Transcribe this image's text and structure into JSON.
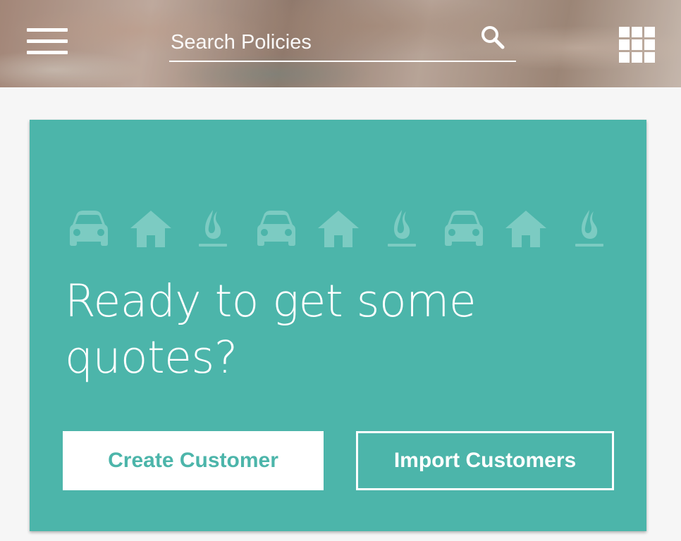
{
  "header": {
    "menu_icon": "hamburger-menu-icon",
    "search": {
      "placeholder": "Search Policies",
      "value": "",
      "icon": "search-icon"
    },
    "apps_icon": "grid-apps-icon"
  },
  "card": {
    "background_color": "#4cb5aa",
    "icon_color": "#7ccbc2",
    "icons": [
      "car-icon",
      "house-icon",
      "flame-icon",
      "car-icon",
      "house-icon",
      "flame-icon",
      "car-icon",
      "house-icon",
      "flame-icon"
    ],
    "headline": "Ready to get some quotes?",
    "primary_button_label": "Create Customer",
    "secondary_button_label": "Import Customers"
  }
}
